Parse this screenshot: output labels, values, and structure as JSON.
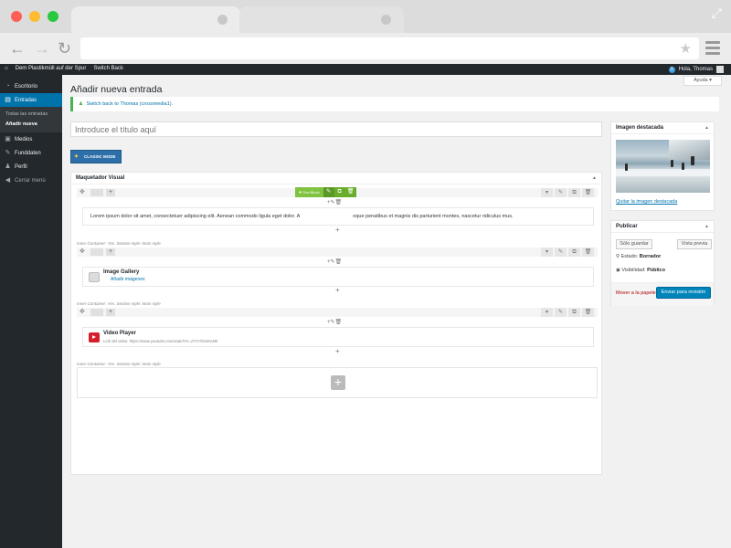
{
  "adminbar": {
    "site_name": "Dem Plastikmüll auf der Spur",
    "switch_back": "Switch Back",
    "notification_count": "0",
    "greeting": "Hola, Thomas"
  },
  "sidebar": {
    "items": [
      {
        "label": "Escritorio",
        "icon": "dashboard-icon"
      },
      {
        "label": "Entradas",
        "icon": "pin-icon"
      },
      {
        "label": "Medios",
        "icon": "media-icon"
      },
      {
        "label": "Funddaten",
        "icon": "tools-icon"
      },
      {
        "label": "Perfil",
        "icon": "user-icon"
      },
      {
        "label": "Cerrar menú",
        "icon": "collapse-icon"
      }
    ],
    "submenu": [
      "Todas las entradas",
      "Añadir nueva"
    ]
  },
  "main": {
    "page_title": "Añadir nueva entrada",
    "help_label": "Ayuda",
    "notice": "Switch back to Thomas (crossmedia1).",
    "title_placeholder": "Introduce el título aquí",
    "classic_mode": "CLASSIC MODE"
  },
  "builder": {
    "title": "Maquetador Visual",
    "text_module_label": "Text Block",
    "text_content_part1": "Lorem ipsum dolor sit amet, consectetuer adipiscing elit. Aenean commodo ligula eget dolor. A",
    "text_content_part2": "oque penatibus et magnis dis parturient montes, nascetur ridiculus mus.",
    "container_note": "Inner Container: Yes. Section style: Main style",
    "gallery_title": "Image Gallery",
    "gallery_link": "Añadir imágenes",
    "video_title": "Video Player",
    "video_link": "Link del video: https://www.youtube.com/watch?v=ZYOTbc0KeMk"
  },
  "featured": {
    "title": "Imagen destacada",
    "remove_link": "Quitar la imagen destacada"
  },
  "publish": {
    "title": "Publicar",
    "save_draft": "Sólo guardar",
    "preview": "Vista previa",
    "status_label": "Estado:",
    "status_value": "Borrador",
    "visibility_label": "Visibilidad:",
    "visibility_value": "Público",
    "trash": "Mover a la papelera",
    "submit": "Enviar para revisión"
  },
  "colors": {
    "wp_dark": "#23282d",
    "wp_blue": "#0073aa",
    "accent_green": "#81c341"
  }
}
